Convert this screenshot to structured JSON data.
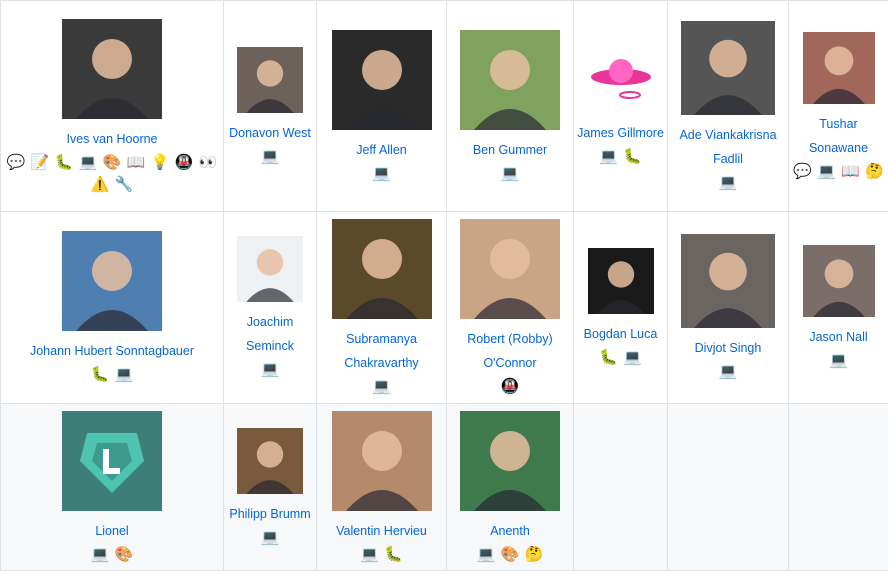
{
  "contributors": [
    {
      "name": "Ives van Hoorne",
      "emojis": [
        "question-icon",
        "docs-icon",
        "bug-icon",
        "code-icon",
        "design-icon",
        "book-icon",
        "ideas-icon",
        "infra-icon",
        "review-icon",
        "warning-icon",
        "tool-icon"
      ]
    },
    {
      "name": "Donavon West",
      "emojis": [
        "code-icon"
      ]
    },
    {
      "name": "Jeff Allen",
      "emojis": [
        "code-icon"
      ]
    },
    {
      "name": "Ben Gummer",
      "emojis": [
        "code-icon"
      ]
    },
    {
      "name": "James Gillmore",
      "emojis": [
        "code-icon",
        "bug-icon"
      ]
    },
    {
      "name": "Ade Viankakrisna Fadlil",
      "emojis": [
        "code-icon"
      ]
    },
    {
      "name": "Tushar Sonawane",
      "emojis": [
        "question-icon",
        "code-icon",
        "book-icon",
        "thinking-icon"
      ]
    },
    {
      "name": "Johann Hubert Sonntagbauer",
      "emojis": [
        "bug-icon",
        "code-icon"
      ]
    },
    {
      "name": "Joachim Seminck",
      "emojis": [
        "code-icon"
      ]
    },
    {
      "name": "Subramanya Chakravarthy",
      "emojis": [
        "code-icon"
      ]
    },
    {
      "name": "Robert (Robby) O'Connor",
      "emojis": [
        "infra-icon"
      ]
    },
    {
      "name": "Bogdan Luca",
      "emojis": [
        "bug-icon",
        "code-icon"
      ]
    },
    {
      "name": "Divjot Singh",
      "emojis": [
        "code-icon"
      ]
    },
    {
      "name": "Jason Nall",
      "emojis": [
        "code-icon"
      ]
    },
    {
      "name": "Lionel",
      "emojis": [
        "code-icon",
        "design-icon"
      ]
    },
    {
      "name": "Philipp Brumm",
      "emojis": [
        "code-icon"
      ]
    },
    {
      "name": "Valentin Hervieu",
      "emojis": [
        "code-icon",
        "bug-icon"
      ]
    },
    {
      "name": "Anenth",
      "emojis": [
        "code-icon",
        "design-icon",
        "thinking-icon"
      ]
    }
  ],
  "colors": {
    "link": "#0366d6",
    "border": "#dfe2e5",
    "alt_row": "#f6f8fa"
  }
}
